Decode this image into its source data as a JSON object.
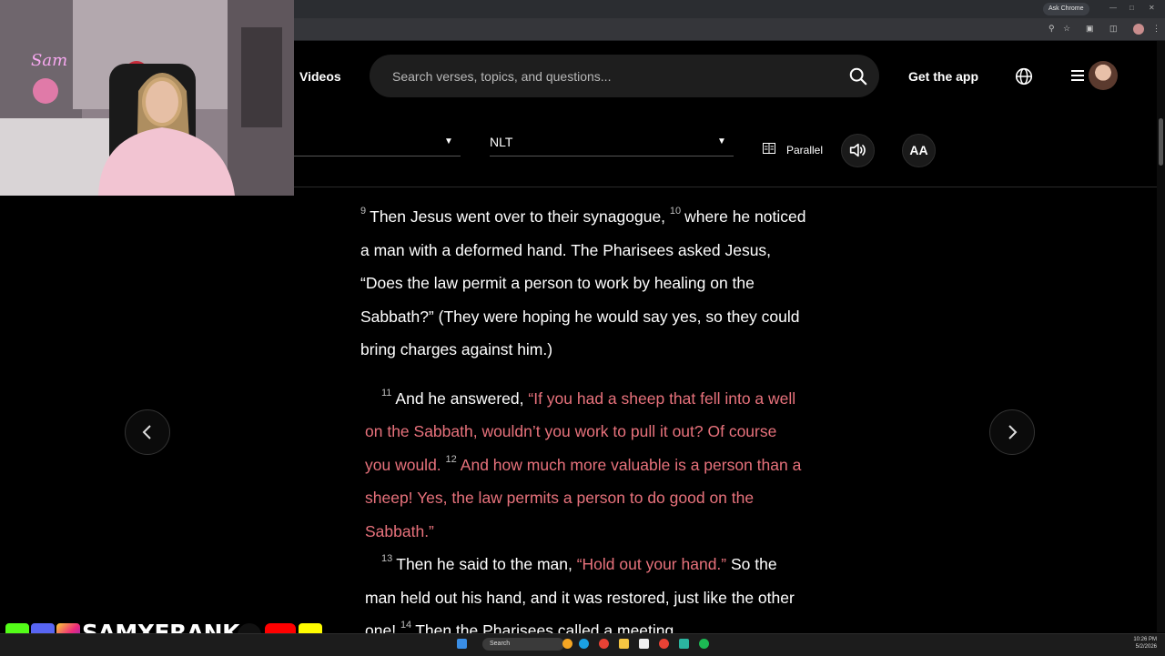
{
  "browser": {
    "ask_chrome": "Ask Chrome"
  },
  "header": {
    "nav_videos": "Videos",
    "search_placeholder": "Search verses, topics, and questions...",
    "get_app": "Get the app"
  },
  "reader": {
    "book_value": "",
    "version": "NLT",
    "parallel_label": "Parallel",
    "font_label": "AA"
  },
  "passage": {
    "verse_9_num": "9",
    "verse_9_text": "Then Jesus went over to their synagogue,",
    "verse_10_num": "10",
    "verse_10_text": "where he noticed a man with a deformed hand. The Pharisees asked Jesus, “Does the law permit a person to work by healing on the Sabbath?” (They were hoping he would say yes, so they could bring charges against him.)",
    "verse_11_num": "11",
    "verse_11_intro": "And he answered,",
    "verse_11_words": "“If you had a sheep that fell into a well on the Sabbath, wouldn’t you work to pull it out? Of course you would.",
    "verse_12_num": "12",
    "verse_12_words": "And how much more valuable is a person than a sheep! Yes, the law permits a person to do good on the Sabbath.”",
    "verse_13_num": "13",
    "verse_13_intro": "Then he said to the man,",
    "verse_13_words": "“Hold out your hand.”",
    "verse_13_rest": "So the man held out his hand, and it was restored, just like the other one!",
    "verse_14_num": "14",
    "verse_14_text": "Then the Pharisees called a meeting"
  },
  "overlay": {
    "social_handle": "SAMXFRANK"
  },
  "taskbar": {
    "search_label": "Search",
    "time": "10:26 PM",
    "date": "5/2/2026"
  },
  "colors": {
    "background": "#000000",
    "words_of_jesus": "#e8727c",
    "search_bg": "#1e1e1e"
  }
}
